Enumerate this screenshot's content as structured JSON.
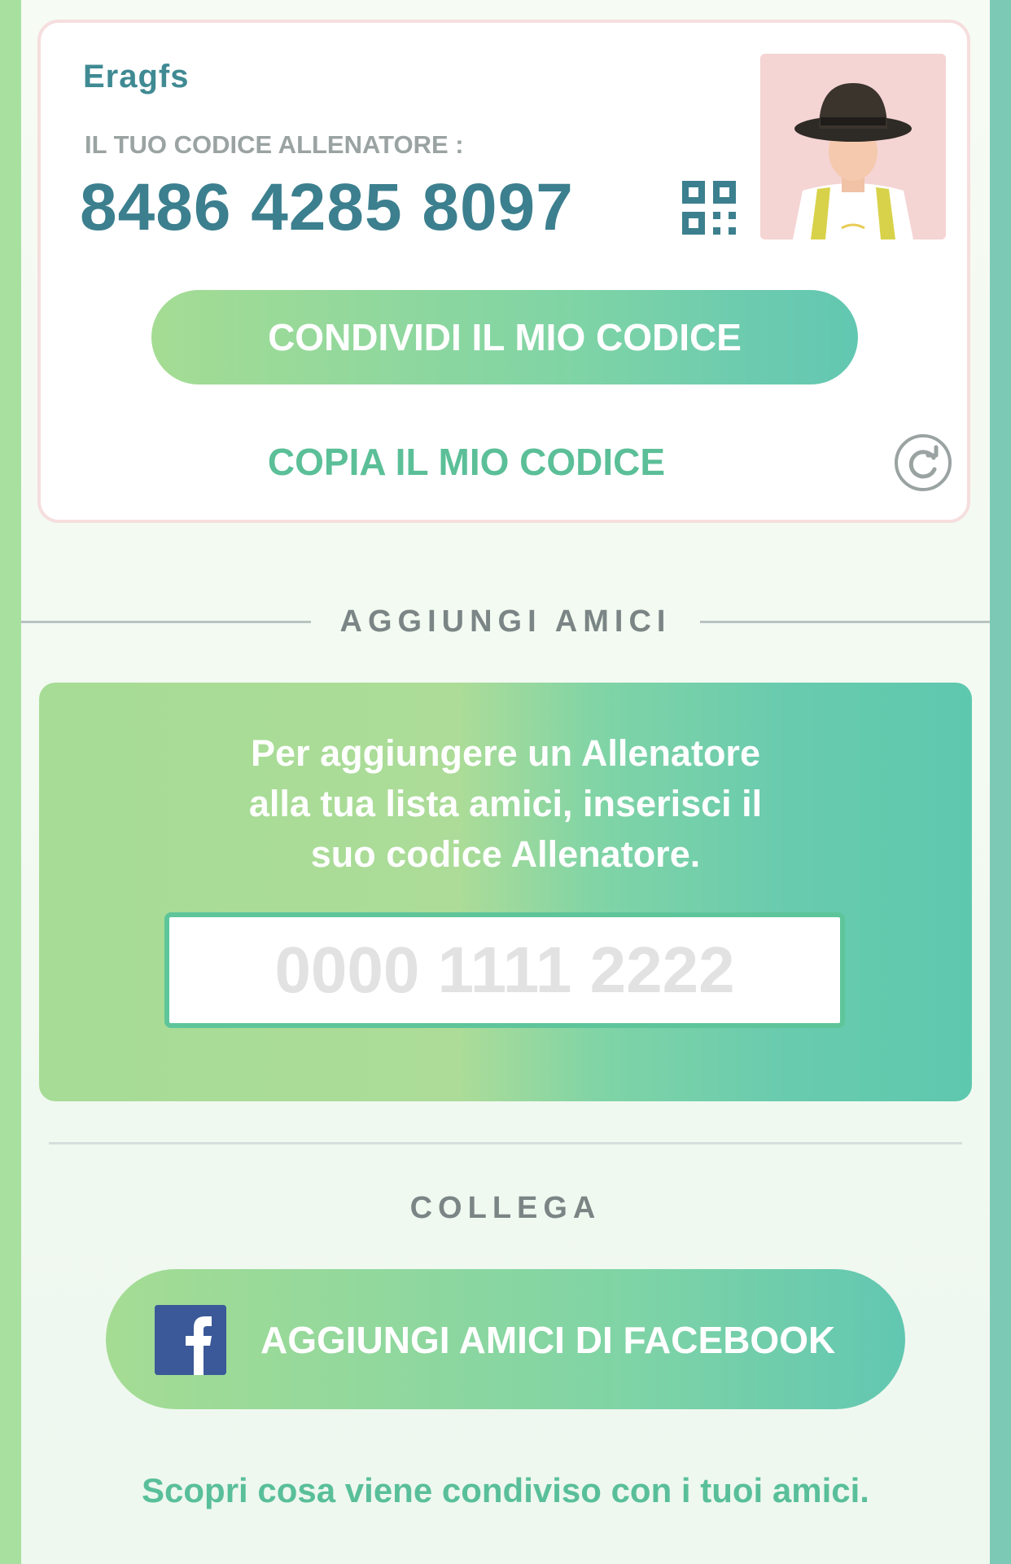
{
  "trainer": {
    "name": "Eragfs",
    "code_label": "IL TUO CODICE ALLENATORE :",
    "code": "8486 4285 8097"
  },
  "actions": {
    "share_label": "CONDIVIDI IL MIO CODICE",
    "copy_label": "COPIA IL MIO CODICE"
  },
  "add_friends": {
    "header": "AGGIUNGI AMICI",
    "instruction_line1": "Per aggiungere un Allenatore",
    "instruction_line2": "alla tua lista amici, inserisci il",
    "instruction_line3": "suo codice Allenatore.",
    "input_placeholder": "0000 1111 2222",
    "input_value": ""
  },
  "connect": {
    "header": "COLLEGA",
    "facebook_button": "AGGIUNGI AMICI DI FACEBOOK",
    "disclaimer_link": "Scopri cosa viene condiviso con i tuoi amici."
  },
  "icons": {
    "qr": "qr-code-icon",
    "refresh": "refresh-icon",
    "facebook": "facebook-icon",
    "avatar": "trainer-avatar"
  },
  "colors": {
    "accent_green": "#5bbf98",
    "code_blue": "#3c7f8e",
    "facebook_blue": "#3b5998"
  }
}
